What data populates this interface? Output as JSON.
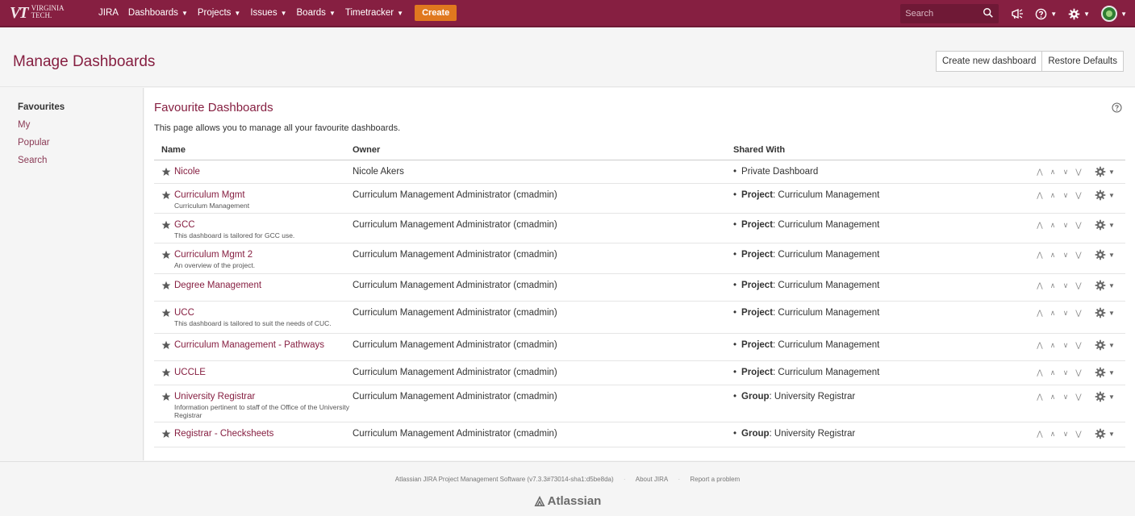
{
  "topnav": {
    "logo_mark": "VT",
    "logo_line1": "VIRGINIA",
    "logo_line2": "TECH.",
    "items": [
      "JIRA",
      "Dashboards",
      "Projects",
      "Issues",
      "Boards",
      "Timetracker"
    ],
    "create_label": "Create",
    "search_placeholder": "Search"
  },
  "header": {
    "title": "Manage Dashboards",
    "create_button": "Create new dashboard",
    "restore_button": "Restore Defaults"
  },
  "sidebar": {
    "items": [
      "Favourites",
      "My",
      "Popular",
      "Search"
    ]
  },
  "main": {
    "title": "Favourite Dashboards",
    "description": "This page allows you to manage all your favourite dashboards.",
    "columns": [
      "Name",
      "Owner",
      "Shared With"
    ],
    "rows": [
      {
        "name": "Nicole",
        "desc": "",
        "owner": "Nicole Akers",
        "share_type": "",
        "share_value": "Private Dashboard"
      },
      {
        "name": "Curriculum Mgmt",
        "desc": "Curriculum Management",
        "owner": "Curriculum Management Administrator (cmadmin)",
        "share_type": "Project",
        "share_value": ": Curriculum Management"
      },
      {
        "name": "GCC",
        "desc": "This dashboard is tailored for GCC use.",
        "owner": "Curriculum Management Administrator (cmadmin)",
        "share_type": "Project",
        "share_value": ": Curriculum Management"
      },
      {
        "name": "Curriculum Mgmt 2",
        "desc": "An overview of the project.",
        "owner": "Curriculum Management Administrator (cmadmin)",
        "share_type": "Project",
        "share_value": ": Curriculum Management"
      },
      {
        "name": "Degree Management",
        "desc": "",
        "owner": "Curriculum Management Administrator (cmadmin)",
        "share_type": "Project",
        "share_value": ": Curriculum Management"
      },
      {
        "name": "UCC",
        "desc": "This dashboard is tailored to suit the needs of CUC.",
        "owner": "Curriculum Management Administrator (cmadmin)",
        "share_type": "Project",
        "share_value": ": Curriculum Management"
      },
      {
        "name": "Curriculum Management - Pathways",
        "desc": "",
        "owner": "Curriculum Management Administrator (cmadmin)",
        "share_type": "Project",
        "share_value": ": Curriculum Management"
      },
      {
        "name": "UCCLE",
        "desc": "",
        "owner": "Curriculum Management Administrator (cmadmin)",
        "share_type": "Project",
        "share_value": ": Curriculum Management"
      },
      {
        "name": "University Registrar",
        "desc": "Information pertinent to staff of the Office of the University Registrar",
        "owner": "Curriculum Management Administrator (cmadmin)",
        "share_type": "Group",
        "share_value": ": University Registrar"
      },
      {
        "name": "Registrar - Checksheets",
        "desc": "",
        "owner": "Curriculum Management Administrator (cmadmin)",
        "share_type": "Group",
        "share_value": ": University Registrar"
      }
    ]
  },
  "footer": {
    "software": "Atlassian JIRA Project Management Software (v7.3.3#73014-sha1:d5be8da)",
    "about": "About JIRA",
    "report": "Report a problem",
    "brand": "Atlassian"
  },
  "colors": {
    "brand": "#861f41",
    "create": "#e0781f"
  }
}
